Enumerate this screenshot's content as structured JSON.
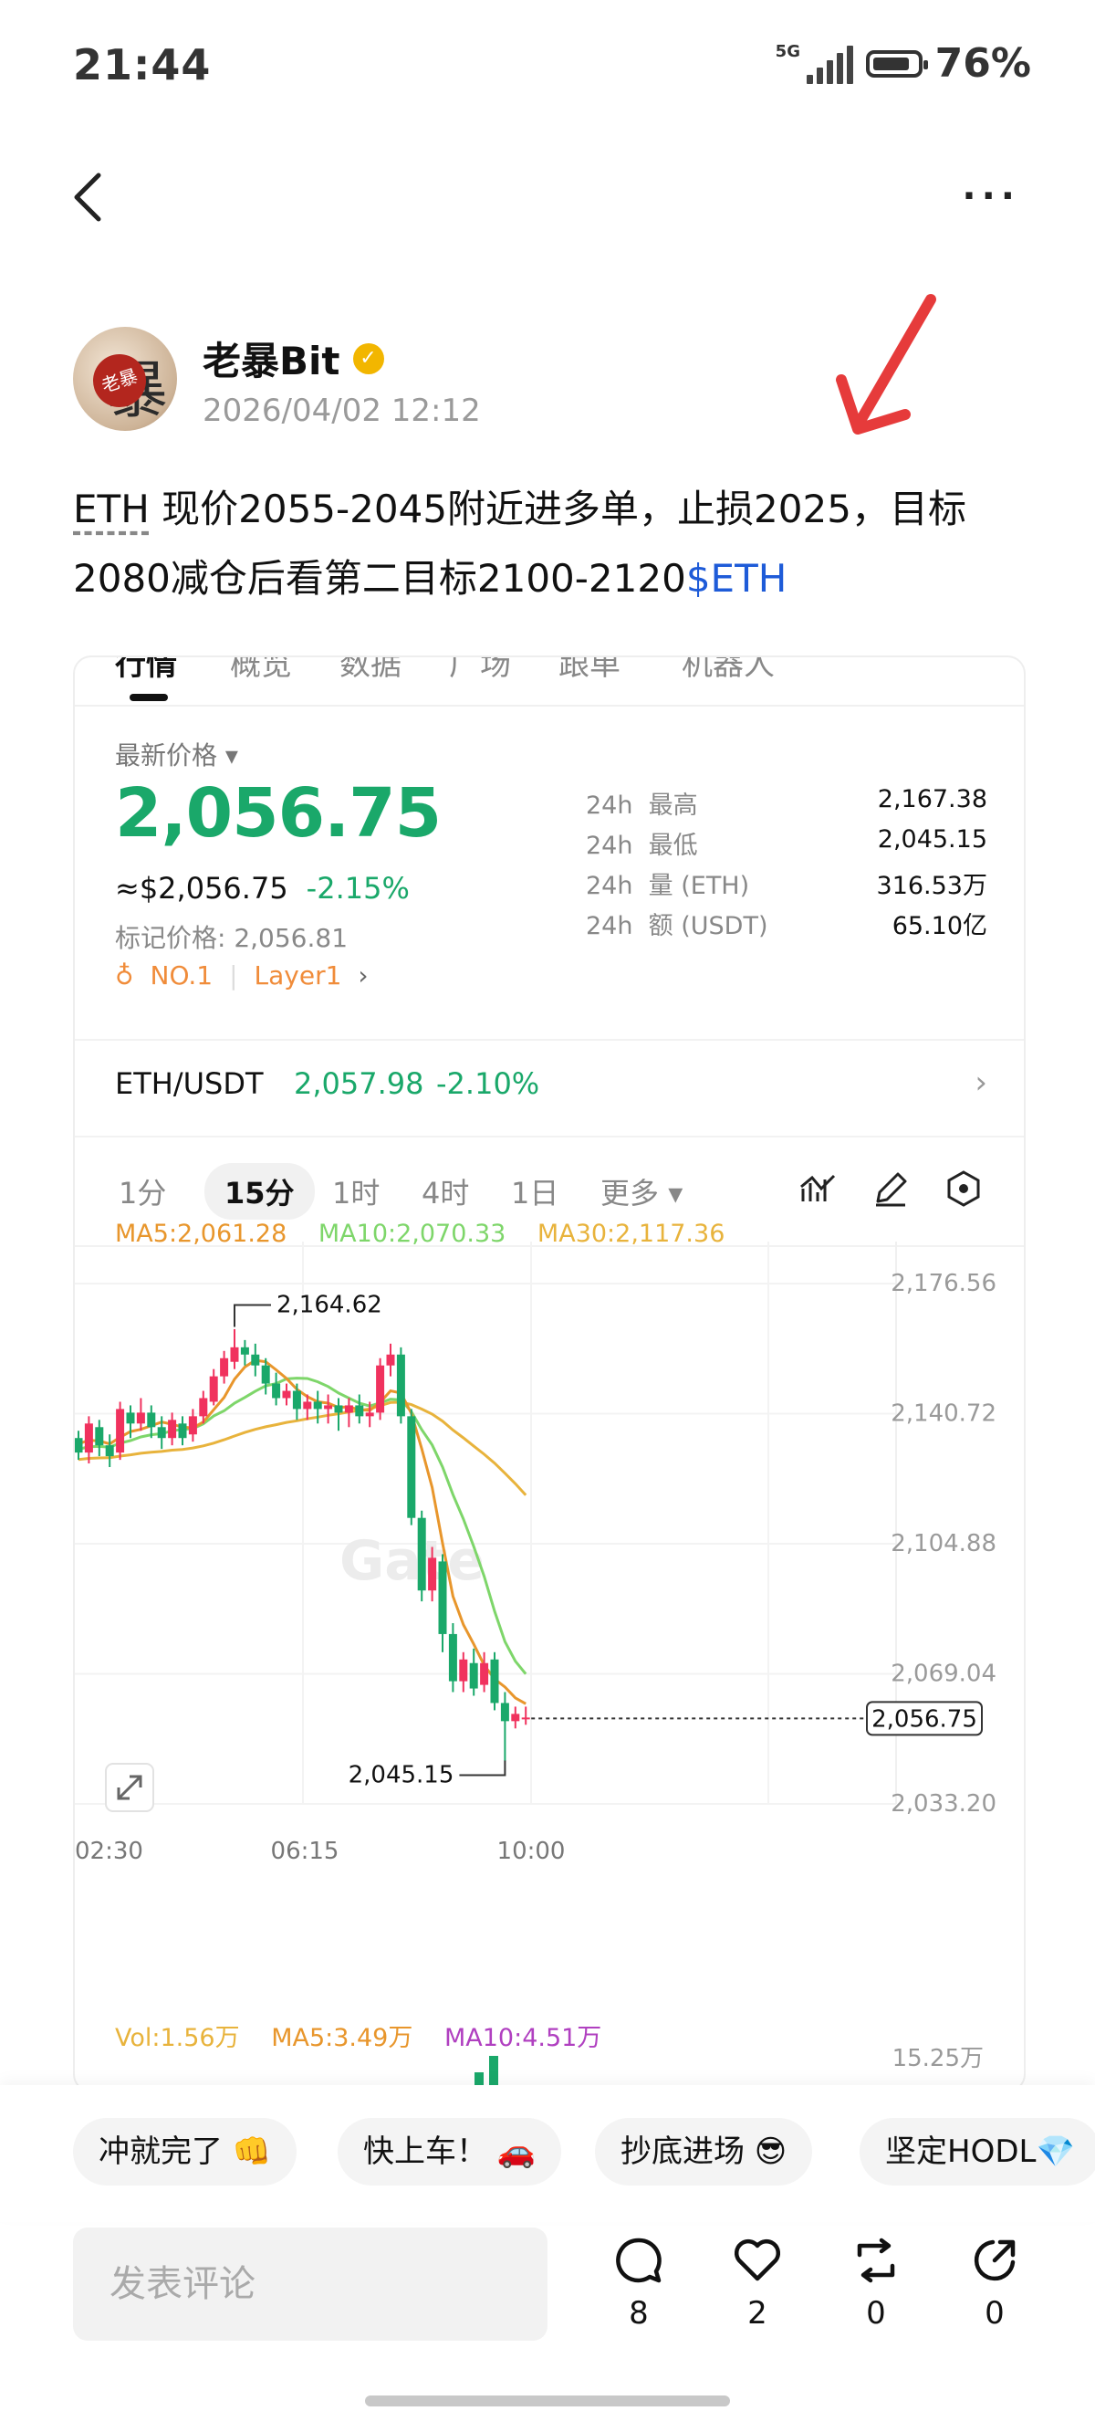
{
  "status_bar": {
    "time": "21:44",
    "network": "5G",
    "battery": "76%"
  },
  "post": {
    "author": "老暴Bit",
    "avatar_text": "老暴",
    "timestamp": "2026/04/02 12:12",
    "text_ticker": "ETH",
    "text_body": " 现价2055-2045附近进多单，止损2025，目标2080减仓后看第二目标2100-2120",
    "text_tag": "$ETH"
  },
  "market_card": {
    "tabs": [
      "行情",
      "概览",
      "数据",
      "广场",
      "跟单",
      "机器人"
    ],
    "latest_label": "最新价格",
    "price": "2,056.75",
    "approx_price": "≈$2,056.75",
    "change": "-2.15%",
    "mark_price": "标记价格: 2,056.81",
    "rank": "NO.1",
    "sector": "Layer1",
    "stats": [
      {
        "period": "24h",
        "label": "最高",
        "value": "2,167.38"
      },
      {
        "period": "24h",
        "label": "最低",
        "value": "2,045.15"
      },
      {
        "period": "24h",
        "label": "量 (ETH)",
        "value": "316.53万"
      },
      {
        "period": "24h",
        "label": "额 (USDT)",
        "value": "65.10亿"
      }
    ],
    "pair": {
      "name": "ETH/USDT",
      "price": "2,057.98",
      "change": "-2.10%"
    },
    "intervals": [
      "1分",
      "15分",
      "1时",
      "4时",
      "1日",
      "更多"
    ],
    "active_interval": "15分"
  },
  "chart_data": {
    "type": "candlestick",
    "ma": {
      "ma5": "MA5:2,061.28",
      "ma10": "MA10:2,070.33",
      "ma30": "MA30:2,117.36"
    },
    "y_ticks": [
      "2,176.56",
      "2,140.72",
      "2,104.88",
      "2,069.04",
      "2,033.20"
    ],
    "ylim": [
      2033.2,
      2176.56
    ],
    "x_ticks": [
      "02:30",
      "06:15",
      "10:00"
    ],
    "high_label": "2,164.62",
    "low_label": "2,045.15",
    "last_price": "2,056.75",
    "watermark": "Gate",
    "candles": [
      [
        2134,
        2130,
        2136,
        2128
      ],
      [
        2130,
        2138,
        2140,
        2127
      ],
      [
        2137,
        2132,
        2139,
        2129
      ],
      [
        2132,
        2129,
        2135,
        2126
      ],
      [
        2130,
        2142,
        2144,
        2128
      ],
      [
        2141,
        2138,
        2143,
        2134
      ],
      [
        2138,
        2141,
        2145,
        2136
      ],
      [
        2141,
        2137,
        2143,
        2134
      ],
      [
        2137,
        2134,
        2140,
        2131
      ],
      [
        2134,
        2139,
        2141,
        2132
      ],
      [
        2138,
        2134,
        2140,
        2132
      ],
      [
        2135,
        2140,
        2142,
        2133
      ],
      [
        2140,
        2145,
        2147,
        2138
      ],
      [
        2144,
        2151,
        2153,
        2143
      ],
      [
        2151,
        2156,
        2158,
        2149
      ],
      [
        2155,
        2159,
        2164,
        2153
      ],
      [
        2159,
        2157,
        2161,
        2154
      ],
      [
        2157,
        2154,
        2160,
        2151
      ],
      [
        2154,
        2149,
        2156,
        2146
      ],
      [
        2149,
        2145,
        2152,
        2143
      ],
      [
        2145,
        2147,
        2149,
        2143
      ],
      [
        2147,
        2142,
        2149,
        2139
      ],
      [
        2142,
        2144,
        2146,
        2139
      ],
      [
        2144,
        2142,
        2147,
        2138
      ],
      [
        2142,
        2143,
        2146,
        2138
      ],
      [
        2143,
        2141,
        2145,
        2136
      ],
      [
        2141,
        2143,
        2145,
        2137
      ],
      [
        2143,
        2140,
        2146,
        2138
      ],
      [
        2140,
        2141,
        2144,
        2137
      ],
      [
        2141,
        2154,
        2156,
        2139
      ],
      [
        2154,
        2157,
        2160,
        2151
      ],
      [
        2157,
        2140,
        2159,
        2138
      ],
      [
        2140,
        2112,
        2142,
        2110
      ],
      [
        2112,
        2092,
        2114,
        2089
      ],
      [
        2092,
        2101,
        2104,
        2089
      ],
      [
        2100,
        2080,
        2102,
        2075
      ],
      [
        2080,
        2067,
        2083,
        2064
      ],
      [
        2067,
        2073,
        2075,
        2064
      ],
      [
        2072,
        2065,
        2076,
        2063
      ],
      [
        2066,
        2072,
        2075,
        2064
      ],
      [
        2073,
        2061,
        2075,
        2059
      ],
      [
        2061,
        2056,
        2064,
        2045
      ],
      [
        2056,
        2058,
        2060,
        2054
      ],
      [
        2057,
        2057,
        2060,
        2055
      ]
    ],
    "volume_legend": {
      "vol": "Vol:1.56万",
      "ma5": "MA5:3.49万",
      "ma10": "MA10:4.51万"
    },
    "volume_top_tick": "15.25万"
  },
  "reactions": [
    "冲就完了 👊",
    "快上车！ 🚗",
    "抄底进场 😎",
    "坚定HODL💎"
  ],
  "comment": {
    "placeholder": "发表评论",
    "counts": {
      "comments": "8",
      "likes": "2",
      "reposts": "0",
      "shares": "0"
    }
  },
  "colors": {
    "up": "#f0325e",
    "down": "#1aa86a",
    "ma5": "#e8962c",
    "ma10": "#7ed66a",
    "ma30": "#e8b33c",
    "link": "#1e5bd8"
  }
}
